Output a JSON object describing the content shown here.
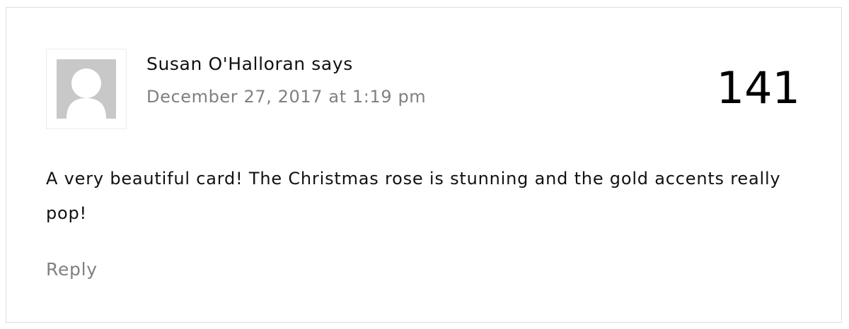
{
  "comment": {
    "author": "Susan O'Halloran",
    "says": "says",
    "timestamp": "December 27, 2017 at 1:19 pm",
    "number": "141",
    "text": "A very beautiful card! The Christmas rose is stunning and the gold accents really pop!",
    "reply_label": "Reply",
    "avatar_icon": "default-avatar-icon"
  }
}
